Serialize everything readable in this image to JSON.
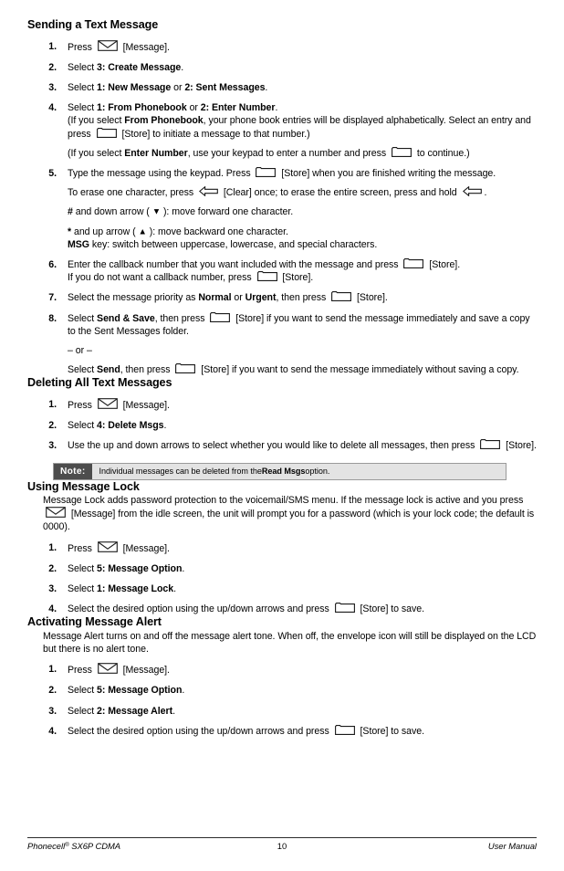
{
  "document": {
    "page_number": "10",
    "footer_left": "Phonecell",
    "footer_left_sup": "®",
    "footer_left_rest": " SX6P CDMA",
    "footer_right": "User Manual"
  },
  "icons": {
    "message_key": "envelope-icon",
    "store_key": "store-softkey-icon",
    "clear_key": "clear-left-arrow-icon",
    "down_arrow": "▼",
    "up_arrow": "▲"
  },
  "sections": [
    {
      "id": "sending-a-text-message",
      "heading": "Sending a Text Message",
      "steps": [
        {
          "num": "1.",
          "parts": [
            {
              "t": "Press "
            },
            {
              "icon": "envelope"
            },
            {
              "t": " [Message]."
            }
          ]
        },
        {
          "num": "2.",
          "parts": [
            {
              "t": "Select "
            },
            {
              "b": "3: Create Message"
            },
            {
              "t": "."
            }
          ]
        },
        {
          "num": "3.",
          "parts": [
            {
              "t": "Select "
            },
            {
              "b": "1: New Message"
            },
            {
              "t": " or "
            },
            {
              "b": "2: Sent Messages"
            },
            {
              "t": "."
            }
          ]
        },
        {
          "num": "4.",
          "parts": [
            {
              "t": "Select "
            },
            {
              "b": "1: From Phonebook"
            },
            {
              "t": " or "
            },
            {
              "b": "2: Enter Number"
            },
            {
              "t": "."
            }
          ],
          "sublines": [
            {
              "gap": false,
              "parts": [
                {
                  "t": "(If you select "
                },
                {
                  "b": "From Phonebook"
                },
                {
                  "t": ", your phone book entries will be displayed alphabetically. Select an entry and press "
                },
                {
                  "icon": "store"
                },
                {
                  "t": " [Store] to initiate a message to that number.)"
                }
              ]
            },
            {
              "gap": true,
              "parts": [
                {
                  "t": "(If you select "
                },
                {
                  "b": "Enter Number"
                },
                {
                  "t": ", use your keypad to enter a number and press "
                },
                {
                  "icon": "store"
                },
                {
                  "t": " to continue.)"
                }
              ]
            }
          ]
        },
        {
          "num": "5.",
          "parts": [
            {
              "t": "Type the message using the keypad. Press "
            },
            {
              "icon": "store"
            },
            {
              "t": " [Store] when you are finished writing the message."
            }
          ],
          "sublines": [
            {
              "gap": true,
              "parts": [
                {
                  "t": "To erase one character, press "
                },
                {
                  "icon": "clear"
                },
                {
                  "t": " [Clear] once; to erase the entire screen, press and hold "
                },
                {
                  "icon": "clear"
                },
                {
                  "t": "."
                }
              ]
            },
            {
              "gap": true,
              "parts": [
                {
                  "b": "#"
                },
                {
                  "t": " and down arrow ( "
                },
                {
                  "tri": "▼"
                },
                {
                  "t": " ): move forward one character."
                }
              ]
            },
            {
              "gap": true,
              "parts": [
                {
                  "b": "*"
                },
                {
                  "t": " and up arrow ( "
                },
                {
                  "tri": "▲"
                },
                {
                  "t": " ): move backward one character."
                }
              ]
            },
            {
              "gap": false,
              "parts": [
                {
                  "b": "MSG"
                },
                {
                  "t": " key: switch between uppercase, lowercase, and special characters."
                }
              ]
            }
          ]
        },
        {
          "num": "6.",
          "parts": [
            {
              "t": "Enter the callback number that you want included with the message and press "
            },
            {
              "icon": "store"
            },
            {
              "t": " [Store]."
            }
          ],
          "sublines": [
            {
              "gap": false,
              "parts": [
                {
                  "t": "If you do not want a callback number, press "
                },
                {
                  "icon": "store"
                },
                {
                  "t": " [Store]."
                }
              ]
            }
          ]
        },
        {
          "num": "7.",
          "parts": [
            {
              "t": "Select the message priority as "
            },
            {
              "b": "Normal"
            },
            {
              "t": " or "
            },
            {
              "b": "Urgent"
            },
            {
              "t": ", then press "
            },
            {
              "icon": "store"
            },
            {
              "t": " [Store]."
            }
          ]
        },
        {
          "num": "8.",
          "parts": [
            {
              "t": "Select "
            },
            {
              "b": "Send & Save"
            },
            {
              "t": ", then press "
            },
            {
              "icon": "store"
            },
            {
              "t": " [Store] if you want to send the message immediately and save a copy to the Sent Messages folder."
            }
          ],
          "sublines": [
            {
              "gap": true,
              "parts": [
                {
                  "t": "– or –"
                }
              ]
            },
            {
              "gap": true,
              "parts": [
                {
                  "t": "Select "
                },
                {
                  "b": "Send"
                },
                {
                  "t": ", then press "
                },
                {
                  "icon": "store"
                },
                {
                  "t": " [Store] if you want to send the message immediately without saving a copy."
                }
              ]
            }
          ]
        }
      ]
    },
    {
      "id": "deleting-all-text-messages",
      "heading": "Deleting All Text Messages",
      "steps": [
        {
          "num": "1.",
          "parts": [
            {
              "t": "Press "
            },
            {
              "icon": "envelope"
            },
            {
              "t": " [Message]."
            }
          ]
        },
        {
          "num": "2.",
          "parts": [
            {
              "t": "Select "
            },
            {
              "b": "4: Delete Msgs"
            },
            {
              "t": "."
            }
          ]
        },
        {
          "num": "3.",
          "parts": [
            {
              "t": "Use the up and down arrows to select whether you would like to delete all messages, then press "
            },
            {
              "icon": "store"
            },
            {
              "t": " [Store]."
            }
          ]
        }
      ],
      "note": {
        "label": "Note:",
        "parts": [
          {
            "t": "Individual messages can be deleted from the "
          },
          {
            "b": "Read Msgs"
          },
          {
            "t": " option."
          }
        ]
      }
    },
    {
      "id": "using-message-lock",
      "heading": "Using Message Lock",
      "intro": [
        {
          "t": "Message Lock adds password protection to the voicemail/SMS menu. If the message lock is active and you press "
        },
        {
          "icon": "envelope"
        },
        {
          "t": " [Message] from the idle screen, the unit will prompt you for a password (which is your lock code; the default is 0000)."
        }
      ],
      "steps": [
        {
          "num": "1.",
          "parts": [
            {
              "t": "Press "
            },
            {
              "icon": "envelope"
            },
            {
              "t": " [Message]."
            }
          ]
        },
        {
          "num": "2.",
          "parts": [
            {
              "t": "Select "
            },
            {
              "b": "5: Message Option"
            },
            {
              "t": "."
            }
          ]
        },
        {
          "num": "3.",
          "parts": [
            {
              "t": "Select "
            },
            {
              "b": "1: Message Lock"
            },
            {
              "t": "."
            }
          ]
        },
        {
          "num": "4.",
          "parts": [
            {
              "t": "Select the desired option using the up/down arrows and press "
            },
            {
              "icon": "store"
            },
            {
              "t": " [Store] to save."
            }
          ]
        }
      ]
    },
    {
      "id": "activating-message-alert",
      "heading": "Activating Message Alert",
      "intro": [
        {
          "t": "Message Alert turns on and off the message alert tone. When off, the envelope icon will still be displayed on the LCD but there is no alert tone."
        }
      ],
      "steps": [
        {
          "num": "1.",
          "parts": [
            {
              "t": "Press "
            },
            {
              "icon": "envelope"
            },
            {
              "t": " [Message]."
            }
          ]
        },
        {
          "num": "2.",
          "parts": [
            {
              "t": "Select "
            },
            {
              "b": "5: Message Option"
            },
            {
              "t": "."
            }
          ]
        },
        {
          "num": "3.",
          "parts": [
            {
              "t": "Select "
            },
            {
              "b": "2: Message Alert"
            },
            {
              "t": "."
            }
          ]
        },
        {
          "num": "4.",
          "parts": [
            {
              "t": "Select the desired option using the up/down arrows and press "
            },
            {
              "icon": "store"
            },
            {
              "t": " [Store] to save."
            }
          ]
        }
      ]
    }
  ]
}
